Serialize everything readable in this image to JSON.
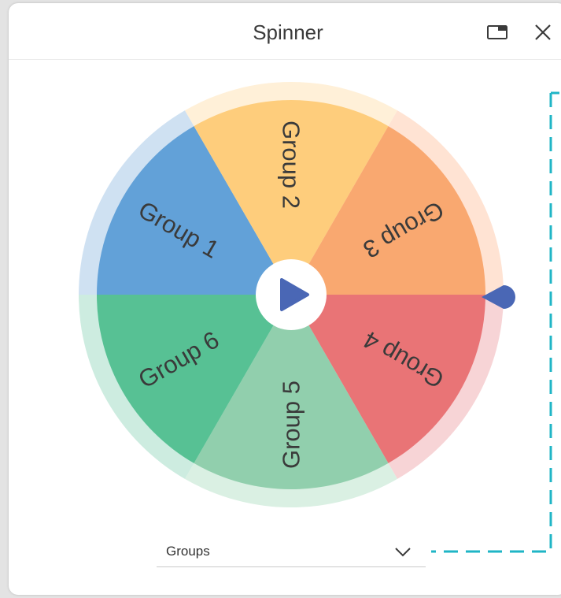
{
  "window": {
    "title": "Spinner"
  },
  "icons": {
    "popout": "popout-window-icon",
    "close": "close-icon",
    "play": "play-icon",
    "pointer": "pointer-marker-icon",
    "chevron": "chevron-down-icon"
  },
  "wheel": {
    "segments": [
      {
        "label": "Group 1",
        "color": "#62a1d8",
        "rim": "#cfe1f2"
      },
      {
        "label": "Group 2",
        "color": "#fecd7c",
        "rim": "#fff0d8"
      },
      {
        "label": "Group 3",
        "color": "#f9a870",
        "rim": "#ffe3d3"
      },
      {
        "label": "Group 4",
        "color": "#e97476",
        "rim": "#f7d4d6"
      },
      {
        "label": "Group 5",
        "color": "#91cfad",
        "rim": "#daf0e3"
      },
      {
        "label": "Group 6",
        "color": "#57c194",
        "rim": "#cdece0"
      }
    ],
    "label_color": "#3a3a3a",
    "play_color": "#4a67b5",
    "pointer_color": "#4a67b5"
  },
  "dropdown": {
    "selected": "Groups"
  },
  "accent": "#1fb5c6"
}
